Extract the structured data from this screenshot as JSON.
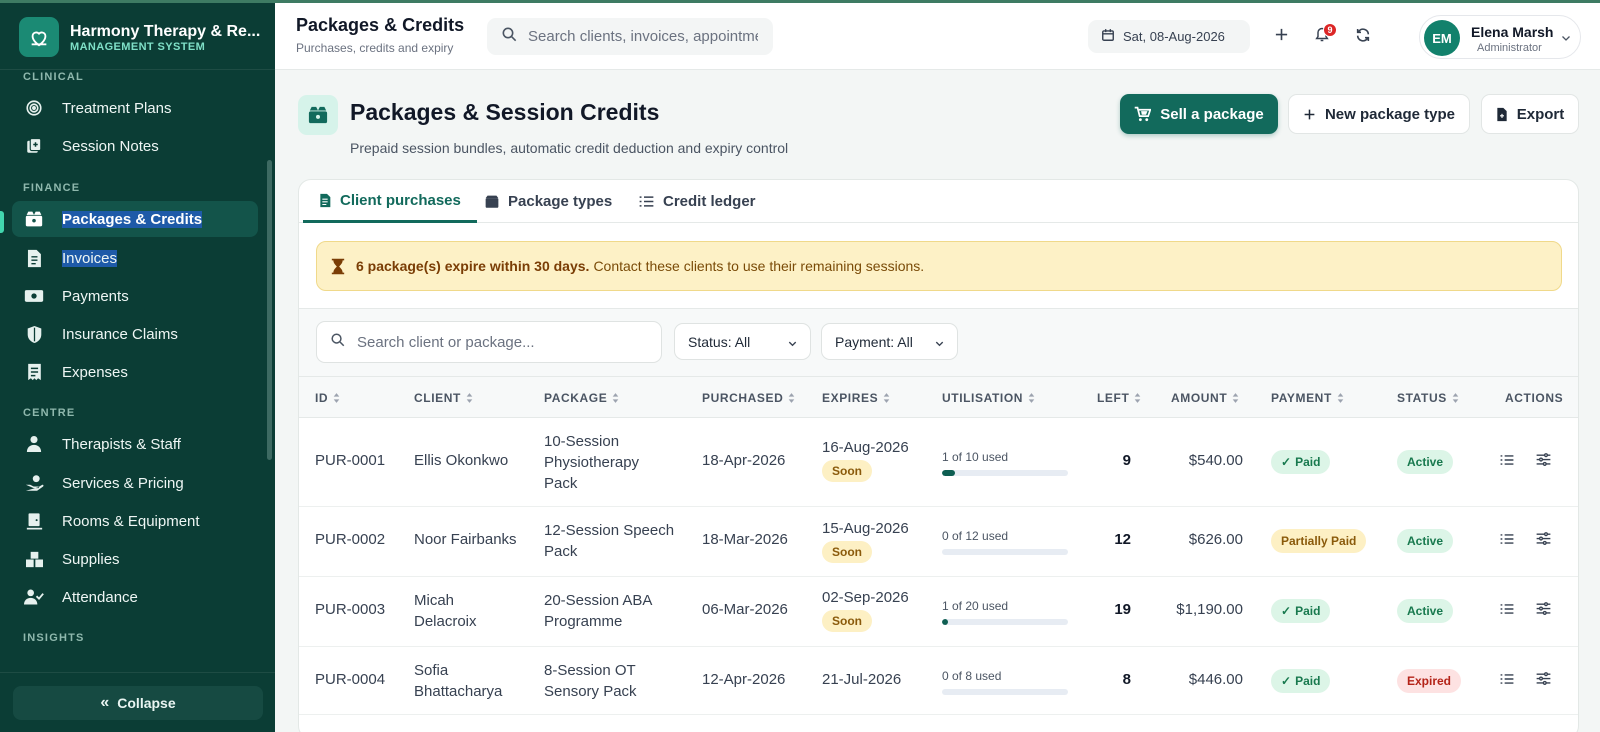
{
  "brand": {
    "name": "Harmony Therapy & Re...",
    "subtitle": "MANAGEMENT SYSTEM"
  },
  "sidebar": {
    "sections": [
      {
        "label": "CLINICAL"
      },
      {
        "label": "FINANCE"
      },
      {
        "label": "CENTRE"
      },
      {
        "label": "INSIGHTS"
      }
    ],
    "items": [
      {
        "label": "Treatment Plans",
        "icon": "target-icon"
      },
      {
        "label": "Session Notes",
        "icon": "note-add-icon"
      },
      {
        "label": "Packages & Credits",
        "icon": "packages-icon"
      },
      {
        "label": "Invoices",
        "icon": "invoice-icon"
      },
      {
        "label": "Payments",
        "icon": "payments-icon"
      },
      {
        "label": "Insurance Claims",
        "icon": "shield-icon"
      },
      {
        "label": "Expenses",
        "icon": "receipt-icon"
      },
      {
        "label": "Therapists & Staff",
        "icon": "person-icon"
      },
      {
        "label": "Services & Pricing",
        "icon": "hand-coin-icon"
      },
      {
        "label": "Rooms & Equipment",
        "icon": "room-icon"
      },
      {
        "label": "Supplies",
        "icon": "supplies-icon"
      },
      {
        "label": "Attendance",
        "icon": "user-check-icon"
      }
    ],
    "collapse_label": "Collapse"
  },
  "header": {
    "title": "Packages & Credits",
    "subtitle": "Purchases, credits and expiry",
    "search_placeholder": "Search clients, invoices, appointments...",
    "date": "Sat, 08-Aug-2026",
    "notification_count": "9",
    "user": {
      "initials": "EM",
      "name": "Elena Marsh",
      "role": "Administrator"
    }
  },
  "page": {
    "title": "Packages & Session Credits",
    "subtitle": "Prepaid session bundles, automatic credit deduction and expiry control",
    "buttons": {
      "sell": "Sell a package",
      "new_type": "New package type",
      "export": "Export"
    }
  },
  "tabs": [
    {
      "label": "Client purchases"
    },
    {
      "label": "Package types"
    },
    {
      "label": "Credit ledger"
    }
  ],
  "alert": {
    "bold": "6 package(s) expire within 30 days.",
    "text": "Contact these clients to use their remaining sessions."
  },
  "filters": {
    "search_placeholder": "Search client or package...",
    "status": "Status: All",
    "payment": "Payment: All"
  },
  "table": {
    "columns": [
      "ID",
      "CLIENT",
      "PACKAGE",
      "PURCHASED",
      "EXPIRES",
      "UTILISATION",
      "LEFT",
      "AMOUNT",
      "PAYMENT",
      "STATUS",
      "ACTIONS"
    ],
    "rows": [
      {
        "id": "PUR-0001",
        "client": "Ellis Okonkwo",
        "package": "10-Session Physiotherapy Pack",
        "purchased": "18-Apr-2026",
        "expires": "16-Aug-2026",
        "expiry_tag": "Soon",
        "used_text": "1 of 10 used",
        "used": 1,
        "total": 10,
        "left": "9",
        "amount": "$540.00",
        "payment": "Paid",
        "status": "Active"
      },
      {
        "id": "PUR-0002",
        "client": "Noor Fairbanks",
        "package": "12-Session Speech Pack",
        "purchased": "18-Mar-2026",
        "expires": "15-Aug-2026",
        "expiry_tag": "Soon",
        "used_text": "0 of 12 used",
        "used": 0,
        "total": 12,
        "left": "12",
        "amount": "$626.00",
        "payment": "Partially Paid",
        "status": "Active"
      },
      {
        "id": "PUR-0003",
        "client": "Micah Delacroix",
        "package": "20-Session ABA Programme",
        "purchased": "06-Mar-2026",
        "expires": "02-Sep-2026",
        "expiry_tag": "Soon",
        "used_text": "1 of 20 used",
        "used": 1,
        "total": 20,
        "left": "19",
        "amount": "$1,190.00",
        "payment": "Paid",
        "status": "Active"
      },
      {
        "id": "PUR-0004",
        "client": "Sofia Bhattacharya",
        "package": "8-Session OT Sensory Pack",
        "purchased": "12-Apr-2026",
        "expires": "21-Jul-2026",
        "expiry_tag": "",
        "used_text": "0 of 8 used",
        "used": 0,
        "total": 8,
        "left": "8",
        "amount": "$446.00",
        "payment": "Paid",
        "status": "Expired"
      }
    ]
  },
  "colors": {
    "sidebar_bg": "#0b3d35",
    "primary": "#126a5c",
    "accent": "#42d6ae",
    "warning_bg": "#fdf1c6"
  }
}
